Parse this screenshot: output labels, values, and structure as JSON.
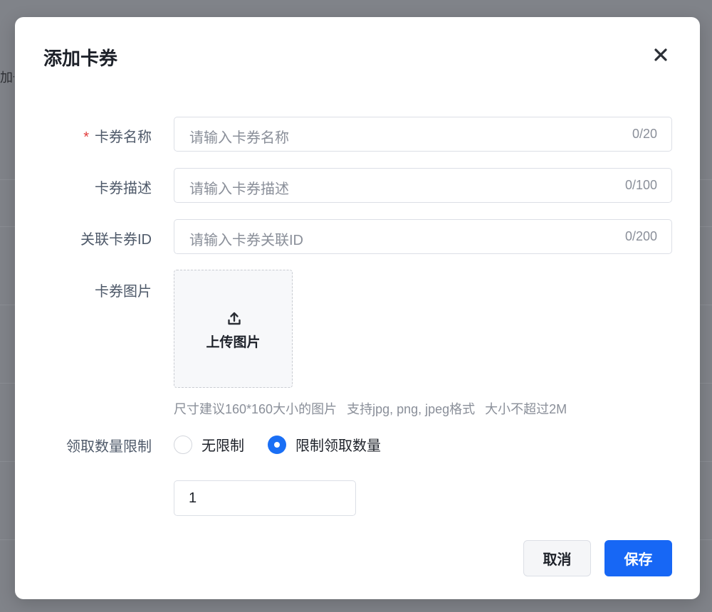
{
  "background": {
    "peek_text": "加一"
  },
  "dialog": {
    "title": "添加卡券",
    "close_icon": "close-icon"
  },
  "form": {
    "name": {
      "label": "卡券名称",
      "required_mark": "*",
      "placeholder": "请输入卡券名称",
      "counter": "0/20"
    },
    "desc": {
      "label": "卡券描述",
      "placeholder": "请输入卡券描述",
      "counter": "0/100"
    },
    "link_id": {
      "label": "关联卡券ID",
      "placeholder": "请输入卡券关联ID",
      "counter": "0/200"
    },
    "image": {
      "label": "卡券图片",
      "upload_label": "上传图片",
      "upload_icon": "upload-icon",
      "hint_size": "尺寸建议160*160大小的图片",
      "hint_format": "支持jpg, png, jpeg格式",
      "hint_limit": "大小不超过2M"
    },
    "limit": {
      "label": "领取数量限制",
      "option_unlimited": "无限制",
      "option_limited": "限制领取数量",
      "selected": "option_limited",
      "quantity": "1"
    }
  },
  "footer": {
    "cancel_label": "取消",
    "save_label": "保存"
  },
  "colors": {
    "primary": "#1767f5",
    "required": "#e23b3b",
    "muted": "#8a8f99",
    "text": "#1d2129"
  }
}
